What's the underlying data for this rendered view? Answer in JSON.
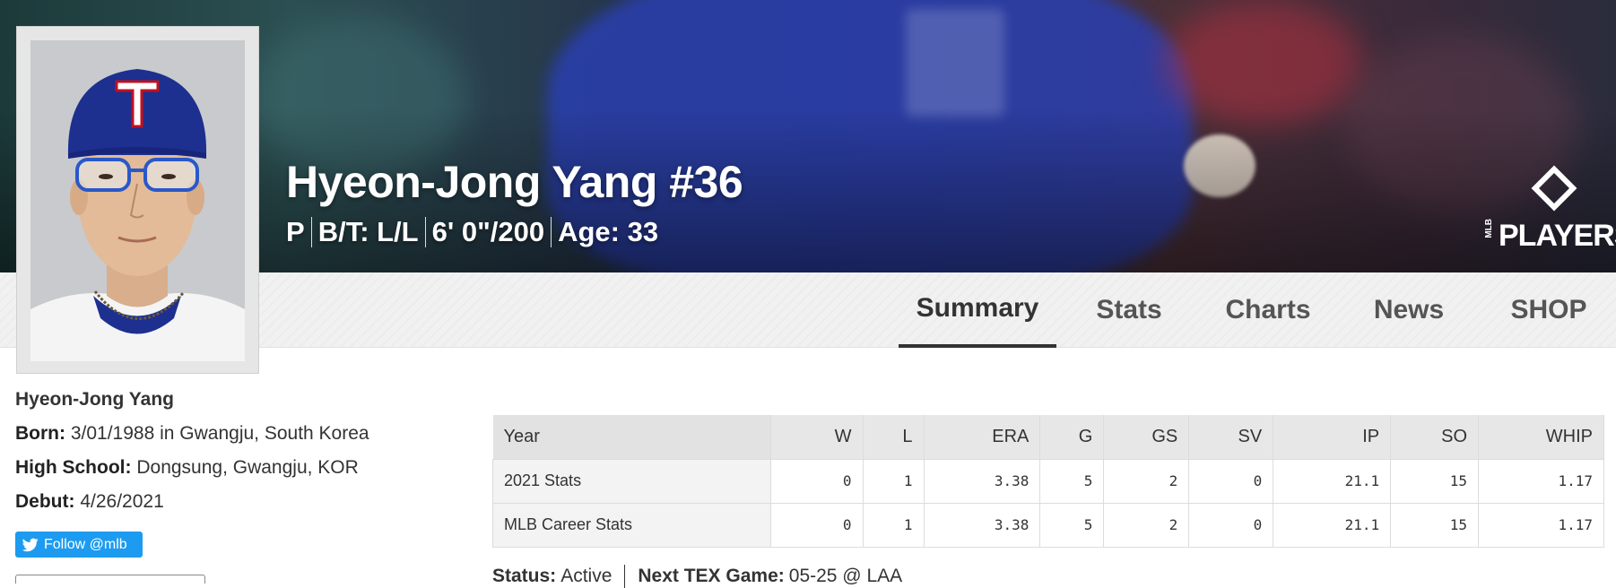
{
  "hero": {
    "player_name": "Hyeon-Jong Yang #36",
    "position": "P",
    "bats_throws": "B/T: L/L",
    "height_weight": "6' 0\"/200",
    "age": "Age: 33",
    "logo_text": "PLAYERS",
    "logo_small": "MLB"
  },
  "nav": {
    "tabs": [
      "Summary",
      "Stats",
      "Charts",
      "News",
      "SHOP"
    ],
    "active": "Summary"
  },
  "bio": {
    "name": "Hyeon-Jong Yang",
    "born_label": "Born:",
    "born_value": "3/01/1988 in Gwangju, South Korea",
    "high_school_label": "High School:",
    "high_school_value": "Dongsung, Gwangju, KOR",
    "debut_label": "Debut:",
    "debut_value": "4/26/2021",
    "follow_label": "Follow @mlb"
  },
  "stats_table": {
    "headers": [
      "Year",
      "W",
      "L",
      "ERA",
      "G",
      "GS",
      "SV",
      "IP",
      "SO",
      "WHIP"
    ],
    "rows": [
      [
        "2021 Stats",
        "0",
        "1",
        "3.38",
        "5",
        "2",
        "0",
        "21.1",
        "15",
        "1.17"
      ],
      [
        "MLB Career Stats",
        "0",
        "1",
        "3.38",
        "5",
        "2",
        "0",
        "21.1",
        "15",
        "1.17"
      ]
    ]
  },
  "status": {
    "status_label": "Status:",
    "status_value": "Active",
    "next_game_label": "Next TEX Game:",
    "next_game_value": "05-25 @ LAA"
  },
  "colors": {
    "twitter_blue": "#1d9bf0",
    "team_blue": "#1d2f8f",
    "team_red": "#c0111f"
  }
}
